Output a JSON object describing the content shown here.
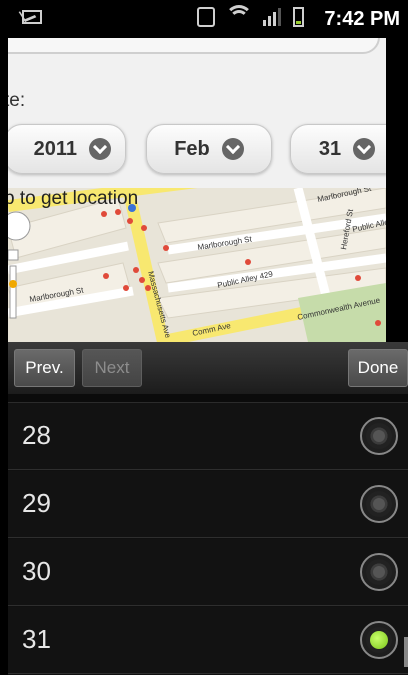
{
  "status_bar": {
    "time": "7:42 PM",
    "icons": [
      "gmail-icon",
      "vibrate-icon",
      "wifi-icon",
      "signal-icon",
      "battery-icon"
    ]
  },
  "form": {
    "date_label": "te:",
    "selects": [
      {
        "value": "2011"
      },
      {
        "value": "Feb"
      },
      {
        "value": "31"
      }
    ],
    "map_hint": "p to get location",
    "map_streets": [
      "Marlborough St",
      "Marlborough St",
      "Public Alley 429",
      "Massachusetts Ave",
      "Comm Ave",
      "Commonwealth Avenue",
      "Hereford St",
      "Public Alle",
      "Marlborough St"
    ]
  },
  "toolbar": {
    "prev_label": "Prev.",
    "next_label": "Next",
    "done_label": "Done"
  },
  "picker": {
    "options": [
      {
        "label": "28",
        "selected": false
      },
      {
        "label": "29",
        "selected": false
      },
      {
        "label": "30",
        "selected": false
      },
      {
        "label": "31",
        "selected": true
      }
    ]
  },
  "colors": {
    "radio_checked": "#7bc61a",
    "toolbar": "#2a2a2a",
    "list_bg": "#121212"
  }
}
